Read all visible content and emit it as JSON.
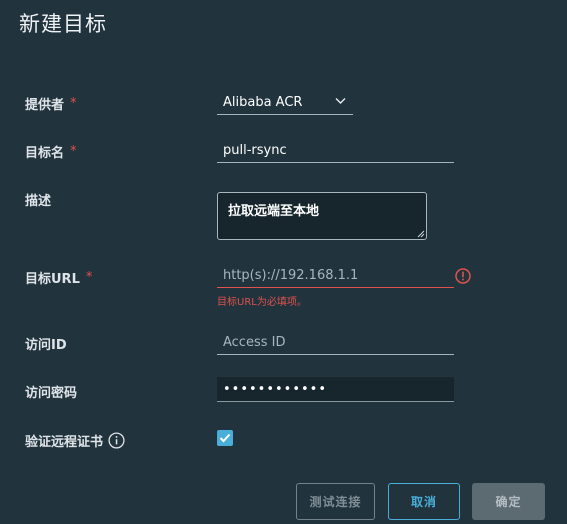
{
  "dialog": {
    "title": "新建目标"
  },
  "form": {
    "provider": {
      "label": "提供者",
      "required_mark": "*",
      "value": "Alibaba ACR"
    },
    "target_name": {
      "label": "目标名",
      "required_mark": "*",
      "value": "pull-rsync"
    },
    "description": {
      "label": "描述",
      "value": "拉取远端至本地"
    },
    "target_url": {
      "label": "目标URL",
      "required_mark": "*",
      "placeholder": "http(s)://192.168.1.1",
      "error": "目标URL为必填项。"
    },
    "access_id": {
      "label": "访问ID",
      "placeholder": "Access ID"
    },
    "access_secret": {
      "label": "访问密码",
      "value": "••••••••••••"
    },
    "verify_cert": {
      "label": "验证远程证书",
      "checked": true
    }
  },
  "buttons": {
    "test": "测试连接",
    "cancel": "取消",
    "ok": "确定"
  },
  "colors": {
    "accent": "#49afd9",
    "error": "#e0524c",
    "background": "#21333d"
  }
}
